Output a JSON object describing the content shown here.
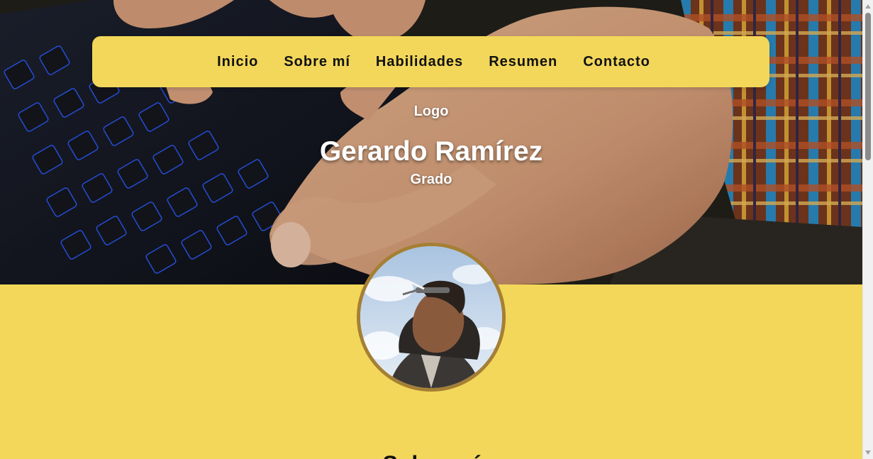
{
  "nav": {
    "items": [
      {
        "label": "Inicio"
      },
      {
        "label": "Sobre mí"
      },
      {
        "label": "Habilidades"
      },
      {
        "label": "Resumen"
      },
      {
        "label": "Contacto"
      }
    ]
  },
  "hero": {
    "logo": "Logo",
    "name": "Gerardo Ramírez",
    "degree": "Grado",
    "background_icon": "keyboard-hands-photo"
  },
  "profile": {
    "avatar_icon": "profile-photo"
  },
  "about": {
    "heading": "Sobre mí"
  },
  "colors": {
    "accent": "#f2d75a",
    "avatar_border": "#a57f34",
    "text_dark": "#111111",
    "text_light": "#ffffff"
  }
}
